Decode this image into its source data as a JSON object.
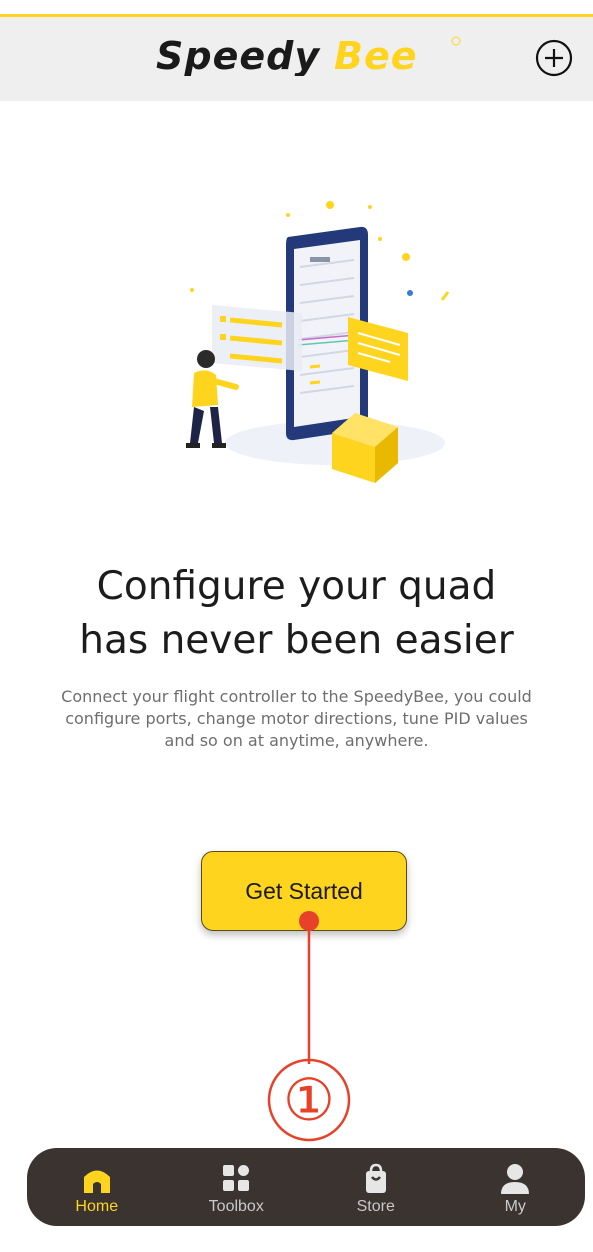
{
  "header": {
    "logo_text": "SpeedyBee",
    "add_icon": "plus-circle-icon"
  },
  "hero": {
    "illustration": "person-configuring-phone-illustration"
  },
  "main": {
    "headline_line1": "Configure your quad",
    "headline_line2": "has never been easier",
    "description_line1": "Connect your flight controller to the SpeedyBee, you could",
    "description_line2": "configure ports, change motor directions, tune PID values",
    "description_line3": "and so on at anytime, anywhere.",
    "cta_label": "Get Started"
  },
  "annotation": {
    "marker": "①",
    "color": "#e8412a"
  },
  "tabbar": {
    "items": [
      {
        "label": "Home",
        "icon": "home-icon",
        "active": true
      },
      {
        "label": "Toolbox",
        "icon": "grid-icon",
        "active": false
      },
      {
        "label": "Store",
        "icon": "shopping-bag-icon",
        "active": false
      },
      {
        "label": "My",
        "icon": "user-icon",
        "active": false
      }
    ]
  },
  "colors": {
    "accent": "#FFD41E",
    "tabbar_bg": "#3a3330",
    "header_bg": "#efefef"
  }
}
